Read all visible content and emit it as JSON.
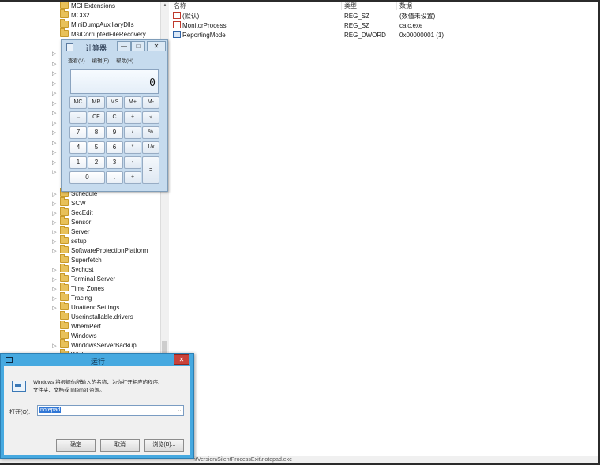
{
  "tree": {
    "items": [
      {
        "label": "MCI Extensions",
        "expander": ""
      },
      {
        "label": "MCI32",
        "expander": ""
      },
      {
        "label": "MiniDumpAuxiliaryDlls",
        "expander": ""
      },
      {
        "label": "MsiCorruptedFileRecovery",
        "expander": ""
      },
      {
        "label": "Schedule",
        "expander": "▷"
      },
      {
        "label": "SCW",
        "expander": "▷"
      },
      {
        "label": "SecEdit",
        "expander": "▷"
      },
      {
        "label": "Sensor",
        "expander": "▷"
      },
      {
        "label": "Server",
        "expander": "▷"
      },
      {
        "label": "setup",
        "expander": "▷"
      },
      {
        "label": "SoftwareProtectionPlatform",
        "expander": "▷"
      },
      {
        "label": "Superfetch",
        "expander": ""
      },
      {
        "label": "Svchost",
        "expander": "▷"
      },
      {
        "label": "Terminal Server",
        "expander": "▷"
      },
      {
        "label": "Time Zones",
        "expander": "▷"
      },
      {
        "label": "Tracing",
        "expander": "▷"
      },
      {
        "label": "UnattendSettings",
        "expander": "▷"
      },
      {
        "label": "Userinstallable.drivers",
        "expander": ""
      },
      {
        "label": "WbemPerf",
        "expander": ""
      },
      {
        "label": "Windows",
        "expander": ""
      },
      {
        "label": "WindowsServerBackup",
        "expander": "▷"
      },
      {
        "label": "Winlogon",
        "expander": "▷"
      }
    ],
    "left_arrows": [
      "▷",
      "▷",
      "▷",
      "▷",
      "▷",
      "▷",
      "▷",
      "▷",
      "▷",
      "▷",
      "▷",
      "▷",
      "▷"
    ]
  },
  "values": {
    "headers": {
      "name": "名称",
      "type": "类型",
      "data": "数据"
    },
    "rows": [
      {
        "name": "(默认)",
        "type": "REG_SZ",
        "data": "(数值未设置)",
        "icon": "string-value-icon"
      },
      {
        "name": "MonitorProcess",
        "type": "REG_SZ",
        "data": "calc.exe",
        "icon": "string-value-icon"
      },
      {
        "name": "ReportingMode",
        "type": "REG_DWORD",
        "data": "0x00000001 (1)",
        "icon": "binary-value-icon"
      }
    ]
  },
  "statusbar": {
    "path": "ntVersion\\SilentProcessExit\\notepad.exe"
  },
  "calculator": {
    "title": "计算器",
    "menu": [
      "查看(V)",
      "编辑(E)",
      "帮助(H)"
    ],
    "display": "0",
    "window_buttons": {
      "minimize": "—",
      "maximize": "□",
      "close": "✕"
    },
    "memory_row": [
      "MC",
      "MR",
      "MS",
      "M+",
      "M-"
    ],
    "row2": [
      "←",
      "CE",
      "C",
      "±",
      "√"
    ],
    "row3": [
      "7",
      "8",
      "9",
      "/",
      "%"
    ],
    "row4": [
      "4",
      "5",
      "6",
      "*",
      "1/x"
    ],
    "row5": [
      "1",
      "2",
      "3",
      "-",
      "="
    ],
    "row6": [
      "0",
      ".",
      "+"
    ]
  },
  "run_dialog": {
    "title": "运行",
    "close": "✕",
    "description_line1": "Windows 将根据你所输入的名称，为你打开相应的程序、",
    "description_line2": "文件夹、文档或 Internet 资源。",
    "open_label": "打开(O):",
    "input_value": "notepad",
    "dropdown_glyph": "⌄",
    "buttons": {
      "ok": "确定",
      "cancel": "取消",
      "browse": "浏览(B)..."
    }
  },
  "colors": {
    "run_titlebar": "#46a9e0",
    "calculator_frame": "#c6dbee",
    "selection": "#3077d6",
    "close_red": "#c9423a"
  }
}
